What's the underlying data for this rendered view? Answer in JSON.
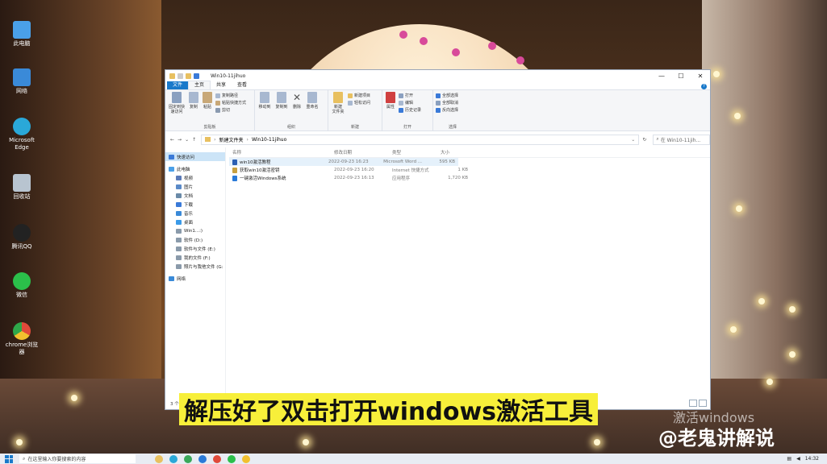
{
  "desktop_icons": [
    {
      "label": "此电脑",
      "icon": "computer-icon",
      "color": "#4aa0e8"
    },
    {
      "label": "网络",
      "icon": "network-icon",
      "color": "#3a8ad8"
    },
    {
      "label": "Microsoft Edge",
      "icon": "edge-icon",
      "color": "#2aa8d8"
    },
    {
      "label": "回收站",
      "icon": "recycle-bin-icon",
      "color": "#b8c4d0"
    },
    {
      "label": "腾讯QQ",
      "icon": "qq-icon",
      "color": "#222222"
    },
    {
      "label": "微信",
      "icon": "wechat-icon",
      "color": "#2bbf4a"
    },
    {
      "label": "chrome浏览器",
      "icon": "chrome-icon",
      "color": "#e04a3a"
    }
  ],
  "window": {
    "title": "Win10-11jihuo",
    "minimize": "—",
    "maximize": "☐",
    "close": "✕",
    "tabs": {
      "file": "文件",
      "home": "主页",
      "share": "共享",
      "view": "查看"
    },
    "help": "?"
  },
  "ribbon": {
    "clipboard": {
      "label": "剪贴板",
      "pin": "固定到快速访问",
      "copy": "复制",
      "paste": "粘贴",
      "copy_path": "复制路径",
      "paste_shortcut": "粘贴快捷方式",
      "cut": "剪切"
    },
    "organize": {
      "label": "组织",
      "move_to": "移动到",
      "copy_to": "复制到",
      "delete": "删除",
      "rename": "重命名"
    },
    "new": {
      "label": "新建",
      "new_folder": "新建\n文件夹",
      "new_item": "新建项目",
      "easy_access": "轻松访问"
    },
    "open": {
      "label": "打开",
      "properties": "属性",
      "open": "打开",
      "edit": "编辑",
      "history": "历史记录"
    },
    "select": {
      "label": "选择",
      "select_all": "全部选择",
      "select_none": "全部取消",
      "invert": "反向选择"
    }
  },
  "address": {
    "path_root": "新建文件夹",
    "path_current": "Win10-11jihuo",
    "search_placeholder": "在 Win10-11jih..."
  },
  "nav_pane": [
    {
      "label": "快速访问",
      "icon": "star-icon",
      "color": "#3a7ad8",
      "sub": false,
      "sel": true
    },
    {
      "label": "此电脑",
      "icon": "computer-icon",
      "color": "#4aa0e8",
      "sub": false,
      "sel": false
    },
    {
      "label": "视频",
      "icon": "video-icon",
      "color": "#5a7ab8",
      "sub": true,
      "sel": false
    },
    {
      "label": "图片",
      "icon": "picture-icon",
      "color": "#5a8ac8",
      "sub": true,
      "sel": false
    },
    {
      "label": "文档",
      "icon": "document-icon",
      "color": "#6a8aa8",
      "sub": true,
      "sel": false
    },
    {
      "label": "下载",
      "icon": "download-icon",
      "color": "#3a7ad8",
      "sub": true,
      "sel": false
    },
    {
      "label": "音乐",
      "icon": "music-icon",
      "color": "#3a8ad8",
      "sub": true,
      "sel": false
    },
    {
      "label": "桌面",
      "icon": "desktop-icon",
      "color": "#3a9ae8",
      "sub": true,
      "sel": false
    },
    {
      "label": "Win1...:)",
      "icon": "drive-icon",
      "color": "#8a9aaa",
      "sub": true,
      "sel": false
    },
    {
      "label": "软件 (D:)",
      "icon": "drive-icon",
      "color": "#8a9aaa",
      "sub": true,
      "sel": false
    },
    {
      "label": "软件与文件 (E:)",
      "icon": "drive-icon",
      "color": "#8a9aaa",
      "sub": true,
      "sel": false
    },
    {
      "label": "我的文件 (F:)",
      "icon": "drive-icon",
      "color": "#8a9aaa",
      "sub": true,
      "sel": false
    },
    {
      "label": "照片与我他文件 (G:",
      "icon": "drive-icon",
      "color": "#8a9aaa",
      "sub": true,
      "sel": false
    },
    {
      "label": "网络",
      "icon": "network-icon",
      "color": "#3a8ad8",
      "sub": false,
      "sel": false
    }
  ],
  "columns": {
    "name": "名称",
    "date": "修改日期",
    "type": "类型",
    "size": "大小"
  },
  "files": [
    {
      "name": "win10激活教程",
      "date": "2022-09-23 16:23",
      "type": "Microsoft Word ...",
      "size": "595 KB",
      "icon": "word-icon",
      "color": "#2b5fb4",
      "sel": true
    },
    {
      "name": "获取win10激活密钥",
      "date": "2022-09-23 16:20",
      "type": "Internet 快捷方式",
      "size": "1 KB",
      "icon": "shortcut-icon",
      "color": "#c8a040",
      "sel": false
    },
    {
      "name": "一键激活Windows系统",
      "date": "2022-09-23 16:13",
      "type": "应用程序",
      "size": "1,720 KB",
      "icon": "app-icon",
      "color": "#2a7ad8",
      "sel": false
    }
  ],
  "status": "3 个项目",
  "caption": "解压好了双击打开windows激活工具",
  "watermark_top": "激活windows",
  "watermark_bottom": "@老鬼讲解说",
  "taskbar": {
    "search_placeholder": "在这里输入你要搜索的内容",
    "time": "14:32"
  }
}
